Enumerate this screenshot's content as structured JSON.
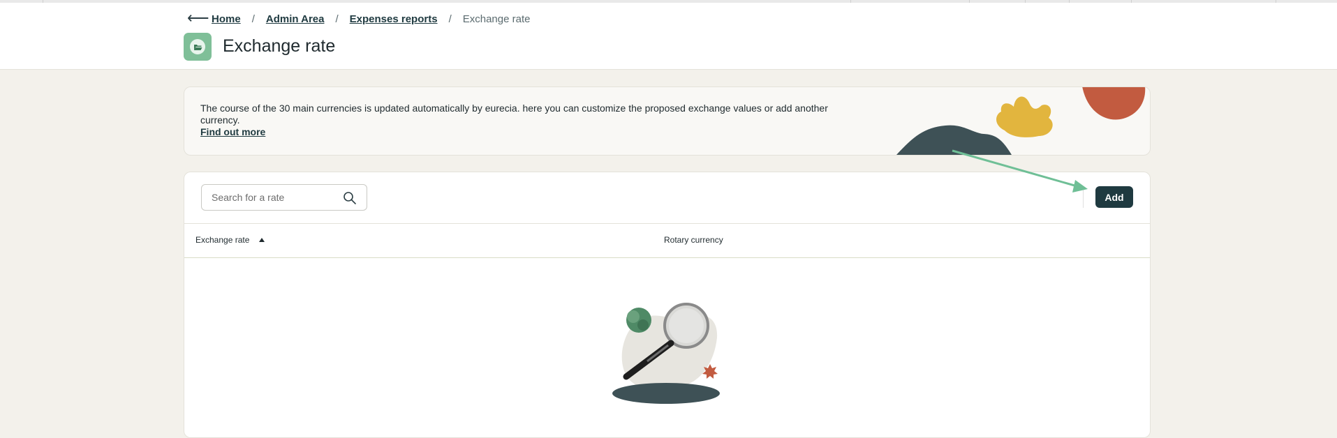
{
  "nav": {
    "back_icon": "back-arrow-icon",
    "breadcrumbs": [
      "Home",
      "Admin Area",
      "Expenses reports"
    ],
    "separator": "/",
    "current": "Exchange rate"
  },
  "header": {
    "title": "Exchange rate",
    "icon": "folder-open-icon",
    "icon_color": "#7fbf98"
  },
  "banner": {
    "text": "The course of the 30 main currencies is updated automatically by eurecia. here you can customize the proposed exchange values or add another currency.",
    "link": "Find out more"
  },
  "toolbar": {
    "search_placeholder": "Search for a rate",
    "search_icon": "search-icon",
    "add_label": "Add",
    "add_color": "#1f3a40",
    "hint_color": "#6fbf96"
  },
  "table": {
    "columns": [
      "Exchange rate",
      "Rotary currency"
    ],
    "sort_column": "Exchange rate",
    "sort_direction": "ascending",
    "rows": [],
    "empty_illustration": "magnifying-glass-illustration"
  }
}
